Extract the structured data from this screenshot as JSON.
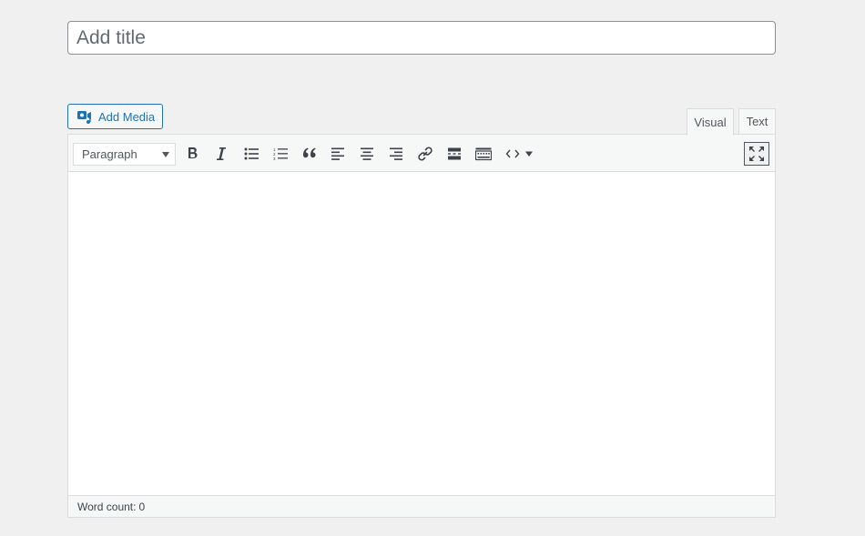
{
  "title_field": {
    "placeholder": "Add title",
    "value": ""
  },
  "media": {
    "add_media_label": "Add Media"
  },
  "tabs": [
    {
      "label": "Visual",
      "active": true
    },
    {
      "label": "Text",
      "active": false
    }
  ],
  "toolbar": {
    "format_selected": "Paragraph",
    "buttons": [
      "bold-icon",
      "italic-icon",
      "bulleted-list-icon",
      "numbered-list-icon",
      "blockquote-icon",
      "align-left-icon",
      "align-center-icon",
      "align-right-icon",
      "link-icon",
      "read-more-icon",
      "toolbar-toggle-icon",
      "code-icon",
      "dropdown-arrow-icon",
      "fullscreen-icon"
    ]
  },
  "editor": {
    "content": ""
  },
  "status": {
    "word_count_label": "Word count: ",
    "word_count": "0"
  },
  "colors": {
    "accent": "#2271b1",
    "background": "#f0f0f1",
    "toolbar": "#f6f7f7",
    "border": "#dcdcde"
  }
}
